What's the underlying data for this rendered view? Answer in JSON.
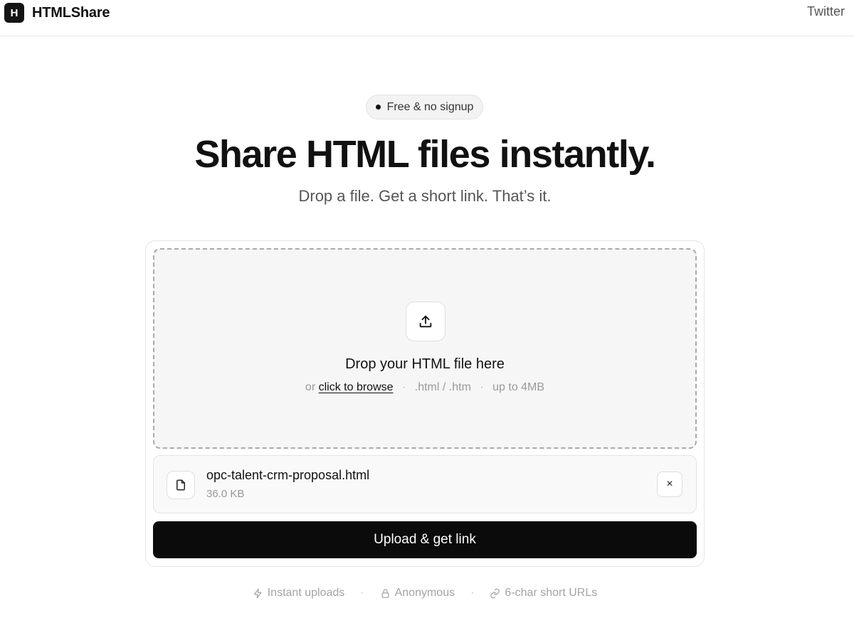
{
  "header": {
    "logo_letter": "H",
    "brand": "HTMLShare",
    "twitter": "Twitter"
  },
  "badge": {
    "text": "Free & no signup"
  },
  "hero": {
    "title": "Share HTML files instantly.",
    "subtitle": "Drop a file. Get a short link. That’s it."
  },
  "dropzone": {
    "icon": "upload-icon",
    "title": "Drop your HTML file here",
    "or": "or",
    "browse": "click to browse",
    "separator": "·",
    "types": ".html / .htm",
    "limit": "up to 4MB"
  },
  "file": {
    "icon": "file-icon",
    "name": "opc-talent-crm-proposal.html",
    "size": "36.0 KB",
    "remove_label": "×"
  },
  "upload_button": {
    "label": "Upload & get link"
  },
  "features": {
    "separator": "·",
    "items": [
      {
        "icon": "lightning-icon",
        "label": "Instant uploads"
      },
      {
        "icon": "lock-icon",
        "label": "Anonymous"
      },
      {
        "icon": "link-icon",
        "label": "6-char short URLs"
      }
    ]
  }
}
